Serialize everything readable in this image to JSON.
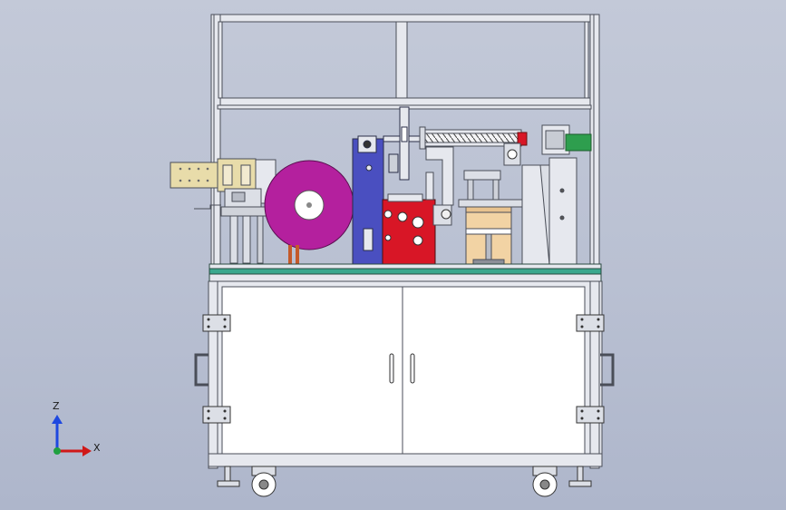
{
  "viewport": {
    "background_top": "#c3c9d8",
    "background_bottom": "#aeb6cb"
  },
  "triad": {
    "z_label": "Z",
    "x_label": "X",
    "z_color": "#1e48e0",
    "x_color": "#d01818",
    "origin_color": "#20a040"
  },
  "colors": {
    "frame": "#e6e8ee",
    "frame_edge": "#4a4e58",
    "table_top": "#3aa88e",
    "cabinet": "#ffffff",
    "feed_plate": "#e8dcaa",
    "roll": "#b4209e",
    "red_unit": "#d81626",
    "blue_block": "#4a4fc0",
    "tan_block": "#f2d3a4",
    "green_motor": "#2e9e4e"
  },
  "icons": [
    "triad-icon",
    "caster-wheel-icon",
    "door-handle-icon",
    "hinge-icon"
  ]
}
